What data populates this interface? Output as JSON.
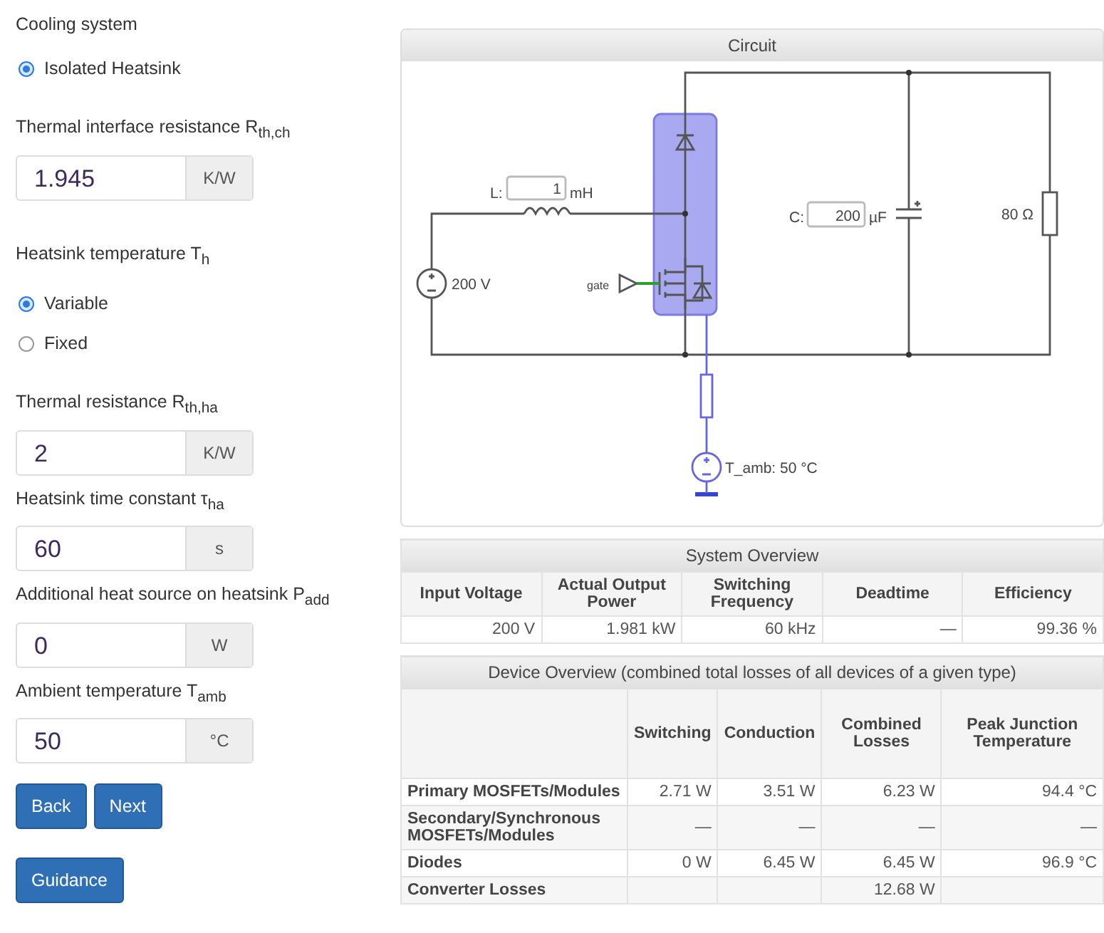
{
  "settings": {
    "groups": [
      [
        {
          "kind": "label",
          "text": "Cooling system"
        },
        {
          "kind": "radio",
          "label": "Isolated Heatsink",
          "selected": true
        }
      ],
      [
        {
          "kind": "label",
          "text": "Thermal interface resistance R$_{th,ch}$"
        },
        {
          "kind": "field",
          "value": "1.945",
          "unit": "K/W"
        }
      ],
      [
        {
          "kind": "label",
          "text": "Heatsink temperature T$_{h}$"
        },
        {
          "kind": "radio",
          "label": "Variable",
          "selected": true
        },
        {
          "kind": "radio",
          "label": "Fixed",
          "selected": false
        }
      ],
      [
        {
          "kind": "label",
          "text": "Thermal resistance R$_{th,ha}$"
        },
        {
          "kind": "field",
          "value": "2",
          "unit": "K/W"
        },
        {
          "kind": "label",
          "text": "Heatsink time constant τ$_{ha}$"
        },
        {
          "kind": "field",
          "value": "60",
          "unit": "s"
        },
        {
          "kind": "label",
          "text": "Additional heat source on heatsink P$_{add}$"
        },
        {
          "kind": "field",
          "value": "0",
          "unit": "W"
        },
        {
          "kind": "label",
          "text": "Ambient temperature T$_{amb}$"
        },
        {
          "kind": "field",
          "value": "50",
          "unit": "°C"
        }
      ]
    ],
    "nav_buttons": [
      "Back",
      "Next"
    ],
    "guidance_button": "Guidance"
  },
  "circuit": {
    "title": "Circuit",
    "inductor_label": "L:",
    "inductance": "1",
    "inductance_unit": "mH",
    "capacitor_label": "C:",
    "capacitance": "200",
    "capacitance_unit": "µF",
    "load": "80 Ω",
    "source": "200 V",
    "gate": "gate",
    "ambient": "T_amb: 50 °C"
  },
  "system_overview": {
    "title": "System Overview",
    "columns": [
      "Input Voltage",
      "Actual Output Power",
      "Switching Frequency",
      "Deadtime",
      "Efficiency"
    ],
    "values": [
      "200 V",
      "1.981 kW",
      "60 kHz",
      "—",
      "99.36 %"
    ]
  },
  "device_overview": {
    "title": "Device Overview (combined total losses of all devices of a given type)",
    "columns": [
      "Switching",
      "Conduction",
      "Combined Losses",
      "Peak Junction Temperature"
    ],
    "rows": [
      {
        "name": "Primary MOSFETs/Modules",
        "cells": [
          "2.71 W",
          "3.51 W",
          "6.23 W",
          "94.4 °C"
        ]
      },
      {
        "name": "Secondary/Synchronous MOSFETs/Modules",
        "cells": [
          "—",
          "—",
          "—",
          "—"
        ]
      },
      {
        "name": "Diodes",
        "cells": [
          "0 W",
          "6.45 W",
          "6.45 W",
          "96.9 °C"
        ]
      },
      {
        "name": "Converter Losses",
        "cells": [
          "",
          "",
          "12.68 W",
          ""
        ]
      }
    ]
  }
}
